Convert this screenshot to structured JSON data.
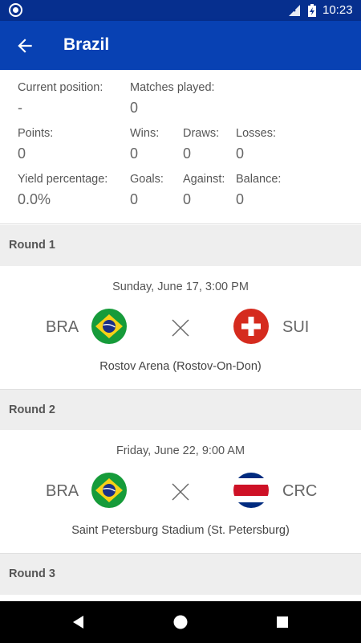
{
  "status_bar": {
    "time": "10:23"
  },
  "app_bar": {
    "title": "Brazil",
    "back_icon": "arrow-back-icon"
  },
  "stats": {
    "current_position": {
      "label": "Current position:",
      "value": "-"
    },
    "matches_played": {
      "label": "Matches played:",
      "value": "0"
    },
    "points": {
      "label": "Points:",
      "value": "0"
    },
    "wins": {
      "label": "Wins:",
      "value": "0"
    },
    "draws": {
      "label": "Draws:",
      "value": "0"
    },
    "losses": {
      "label": "Losses:",
      "value": "0"
    },
    "yield": {
      "label": "Yield percentage:",
      "value": "0.0%"
    },
    "goals": {
      "label": "Goals:",
      "value": "0"
    },
    "against": {
      "label": "Against:",
      "value": "0"
    },
    "balance": {
      "label": "Balance:",
      "value": "0"
    }
  },
  "rounds": [
    {
      "label": "Round 1",
      "date": "Sunday, June 17, 3:00 PM",
      "home": "BRA",
      "away": "SUI",
      "venue": "Rostov Arena (Rostov-On-Don)"
    },
    {
      "label": "Round 2",
      "date": "Friday, June 22, 9:00 AM",
      "home": "BRA",
      "away": "CRC",
      "venue": "Saint Petersburg Stadium (St. Petersburg)"
    },
    {
      "label": "Round 3"
    }
  ],
  "colors": {
    "status_bar": "#062f8e",
    "app_bar": "#0841b3",
    "section_header": "#eeeeee"
  }
}
